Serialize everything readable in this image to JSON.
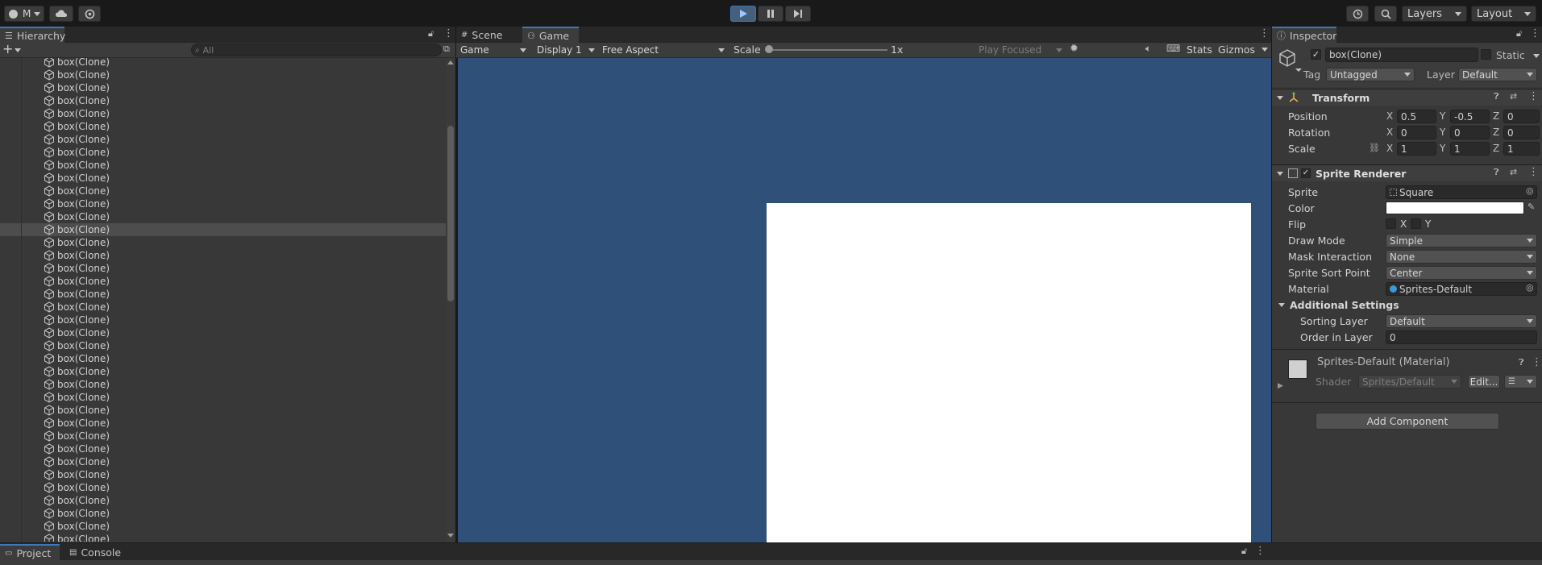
{
  "toolbar": {
    "account_label": "M",
    "play_icon": "play-icon",
    "pause_icon": "pause-icon",
    "step_icon": "step-icon",
    "layers_label": "Layers",
    "layout_label": "Layout"
  },
  "hierarchy": {
    "tab_label": "Hierarchy",
    "search_placeholder": "All",
    "item_label": "box(Clone)",
    "item_count": 38,
    "selected_index": 13
  },
  "game_view": {
    "tabs": [
      "Scene",
      "Game"
    ],
    "active_tab": "Game",
    "mode_label": "Game",
    "display_label": "Display 1",
    "aspect_label": "Free Aspect",
    "scale_label": "Scale",
    "scale_value": "1x",
    "play_focused_label": "Play Focused",
    "stats_label": "Stats",
    "gizmos_label": "Gizmos",
    "background_color": "#2f5078",
    "sprite_color": "#ffffff"
  },
  "inspector": {
    "tab_label": "Inspector",
    "object_name": "box(Clone)",
    "static_label": "Static",
    "tag_label": "Tag",
    "tag_value": "Untagged",
    "layer_label": "Layer",
    "layer_value": "Default",
    "transform": {
      "title": "Transform",
      "position_label": "Position",
      "rotation_label": "Rotation",
      "scale_label": "Scale",
      "position": {
        "x": "0.5",
        "y": "-0.5",
        "z": "0"
      },
      "rotation": {
        "x": "0",
        "y": "0",
        "z": "0"
      },
      "scale": {
        "x": "1",
        "y": "1",
        "z": "1"
      }
    },
    "sprite_renderer": {
      "title": "Sprite Renderer",
      "sprite_label": "Sprite",
      "sprite_value": "Square",
      "color_label": "Color",
      "flip_label": "Flip",
      "flip_x": "X",
      "flip_y": "Y",
      "draw_mode_label": "Draw Mode",
      "draw_mode_value": "Simple",
      "mask_label": "Mask Interaction",
      "mask_value": "None",
      "sort_point_label": "Sprite Sort Point",
      "sort_point_value": "Center",
      "material_label": "Material",
      "material_value": "Sprites-Default",
      "additional_label": "Additional Settings",
      "sorting_layer_label": "Sorting Layer",
      "sorting_layer_value": "Default",
      "order_label": "Order in Layer",
      "order_value": "0"
    },
    "material": {
      "title": "Sprites-Default (Material)",
      "shader_label": "Shader",
      "shader_value": "Sprites/Default",
      "edit_label": "Edit..."
    },
    "add_component_label": "Add Component"
  },
  "bottom": {
    "project_label": "Project",
    "console_label": "Console"
  }
}
